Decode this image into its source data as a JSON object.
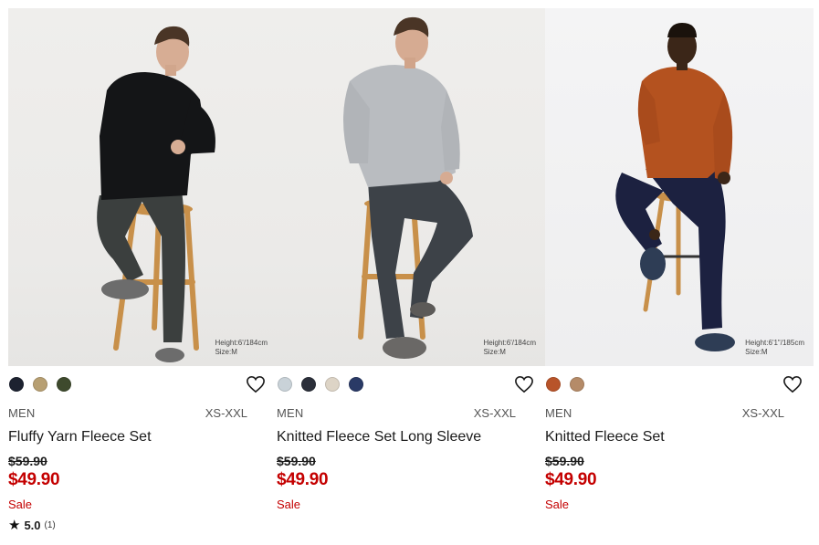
{
  "products": [
    {
      "caption_line1": "Height:6'/184cm",
      "caption_line2": "Size:M",
      "colors": [
        "#1d2230",
        "#b79f72",
        "#3e4a2d"
      ],
      "gender": "MEN",
      "sizes": "XS-XXL",
      "name": "Fluffy Yarn Fleece Set",
      "old_price": "$59.90",
      "new_price": "$49.90",
      "sale": "Sale",
      "rating_score": "5.0",
      "rating_count": "(1)"
    },
    {
      "caption_line1": "Height:6'/184cm",
      "caption_line2": "Size:M",
      "colors": [
        "#c9d2d8",
        "#2b2f3a",
        "#ddd4c6",
        "#2a3a66"
      ],
      "gender": "MEN",
      "sizes": "XS-XXL",
      "name": "Knitted Fleece Set Long Sleeve",
      "old_price": "$59.90",
      "new_price": "$49.90",
      "sale": "Sale"
    },
    {
      "caption_line1": "Height:6'1\"/185cm",
      "caption_line2": "Size:M",
      "colors": [
        "#b8542a",
        "#b58b68"
      ],
      "gender": "MEN",
      "sizes": "XS-XXL",
      "name": "Knitted Fleece Set",
      "old_price": "$59.90",
      "new_price": "$49.90",
      "sale": "Sale"
    }
  ],
  "icons": {
    "wishlist": "heart-outline-icon",
    "rating": "star-icon"
  },
  "accent_sale_color": "#c40000"
}
